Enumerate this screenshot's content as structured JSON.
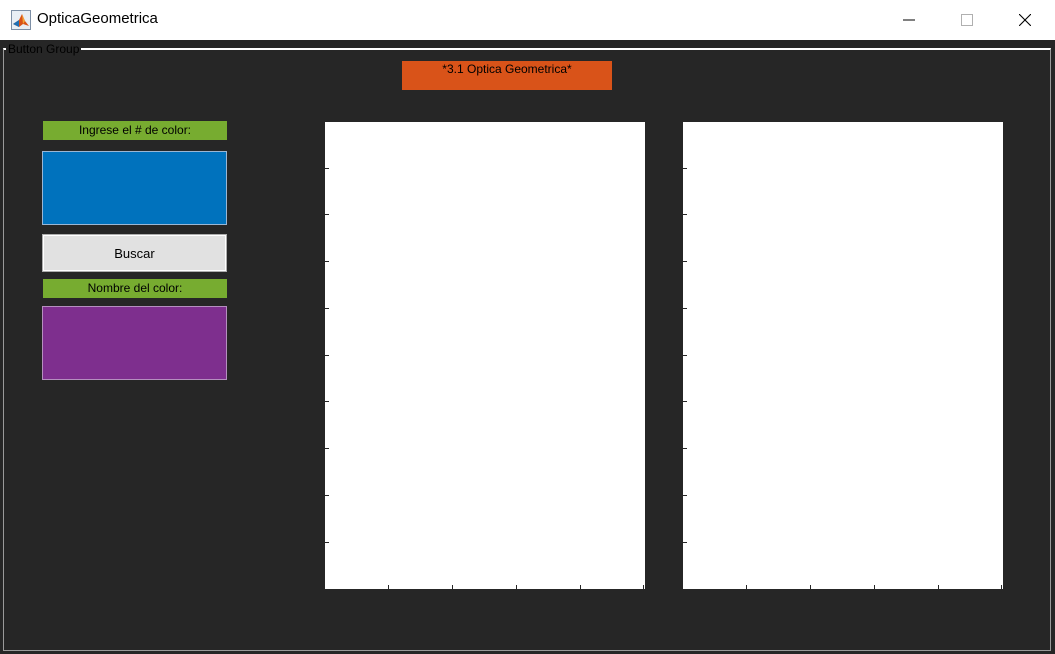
{
  "window": {
    "title": "OpticaGeometrica",
    "icon": "matlab-icon",
    "controls": [
      "minimize-icon",
      "maximize-icon",
      "close-icon"
    ]
  },
  "button_group": {
    "title": "Button Group"
  },
  "header": {
    "text": "*3.1 Optica Geometrica*",
    "color": "#d95319"
  },
  "left_panel": {
    "input_label": "Ingrese el # de color:",
    "input_color": "#0072bd",
    "search_button": "Buscar",
    "output_label": "Nombre del color:",
    "output_color": "#7e2f8e",
    "label_color": "#77ac30"
  },
  "axes": {
    "count": 2,
    "background": "#ffffff"
  }
}
